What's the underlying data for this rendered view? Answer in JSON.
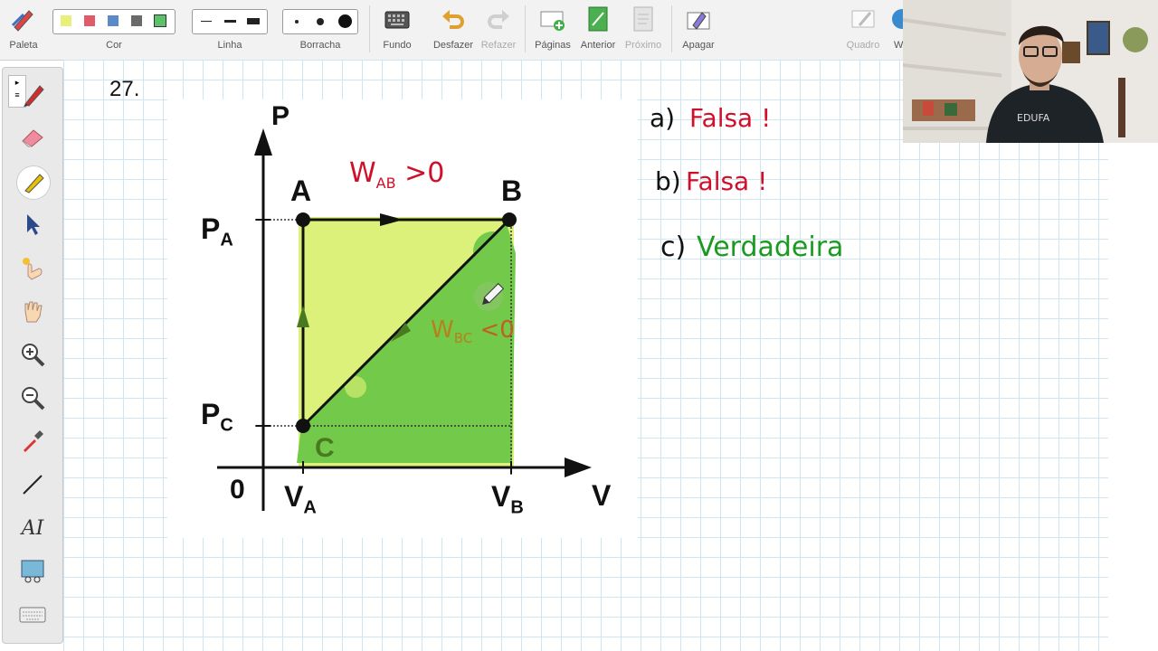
{
  "toolbar": {
    "paleta": "Paleta",
    "cor": "Cor",
    "linha": "Linha",
    "borracha": "Borracha",
    "fundo": "Fundo",
    "desfazer": "Desfazer",
    "refazer": "Refazer",
    "paginas": "Páginas",
    "anterior": "Anterior",
    "proximo": "Próximo",
    "apagar": "Apagar",
    "quadro": "Quadro",
    "w": "W",
    "colors": [
      "#e8f07a",
      "#e05a6a",
      "#5a8ac8",
      "#6a6a6a",
      "#5cc26a"
    ]
  },
  "page": {
    "question_number": "27."
  },
  "diagram": {
    "axis_p": "P",
    "axis_v": "V",
    "origin": "0",
    "label_a": "A",
    "label_b": "B",
    "label_c": "C",
    "p_a": "PA",
    "p_a_main": "P",
    "p_a_sub": "A",
    "p_c_main": "P",
    "p_c_sub": "C",
    "v_a_main": "V",
    "v_a_sub": "A",
    "v_b_main": "V",
    "v_b_sub": "B",
    "w_ab": "WAB > 0",
    "w_ab_main": "W",
    "w_ab_sub": "AB",
    "w_ab_rest": " >0",
    "w_bc_main": "W",
    "w_bc_sub": "BC",
    "w_bc_rest": " <0"
  },
  "notes": {
    "a_prefix": "a)",
    "a_text": "Falsa !",
    "b_prefix": "b)",
    "b_text": "Falsa !",
    "c_prefix": "c)",
    "c_text": "Verdadeira",
    "color_false": "#d0102a",
    "color_true": "#1a9a20"
  }
}
